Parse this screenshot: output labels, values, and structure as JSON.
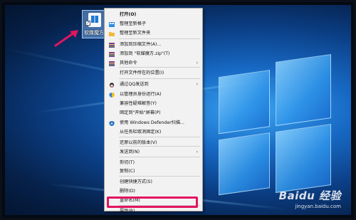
{
  "desktop": {
    "icon_label": "软媒魔方"
  },
  "menu": {
    "items": [
      {
        "label": "打开(O)",
        "bold": true,
        "icon": ""
      },
      {
        "label": "整理至新格子",
        "icon": "fences-icon"
      },
      {
        "label": "整理至新文件夹",
        "icon": "folder-icon"
      },
      {
        "label": "添加到压缩文件(A)...",
        "icon": "archive-icon"
      },
      {
        "label": "添加到 \"软媒魔方.zip\"(T)",
        "icon": "archive-icon"
      },
      {
        "label": "其他命令",
        "icon": "archive-icon",
        "submenu": "›"
      },
      {
        "label": "打开文件所在的位置(I)",
        "icon": ""
      },
      {
        "label": "通过QQ发送到",
        "icon": "qq-icon",
        "submenu": "›"
      },
      {
        "label": "以管理员身份运行(A)",
        "icon": "shield-icon"
      },
      {
        "label": "兼容性疑难解答(Y)",
        "icon": ""
      },
      {
        "label": "固定到\"开始\"屏幕(P)",
        "icon": ""
      },
      {
        "label": "使用 Windows Defender扫描...",
        "icon": "defender-icon"
      },
      {
        "label": "从任务栏取消固定(K)",
        "icon": ""
      },
      {
        "label": "还原以前的版本(V)",
        "icon": ""
      },
      {
        "label": "发送到(N)",
        "icon": "",
        "submenu": "›"
      },
      {
        "label": "剪切(T)",
        "icon": ""
      },
      {
        "label": "复制(C)",
        "icon": ""
      },
      {
        "label": "创建快捷方式(S)",
        "icon": ""
      },
      {
        "label": "删除(D)",
        "icon": ""
      },
      {
        "label": "重命名(M)",
        "icon": ""
      },
      {
        "label": "属性(R)",
        "icon": ""
      }
    ]
  },
  "watermark": {
    "brand": "Baidu 经验",
    "url": "jingyan.baidu.com"
  },
  "colors": {
    "highlight": "#e31460",
    "menu_bg": "#f2f2f2"
  }
}
